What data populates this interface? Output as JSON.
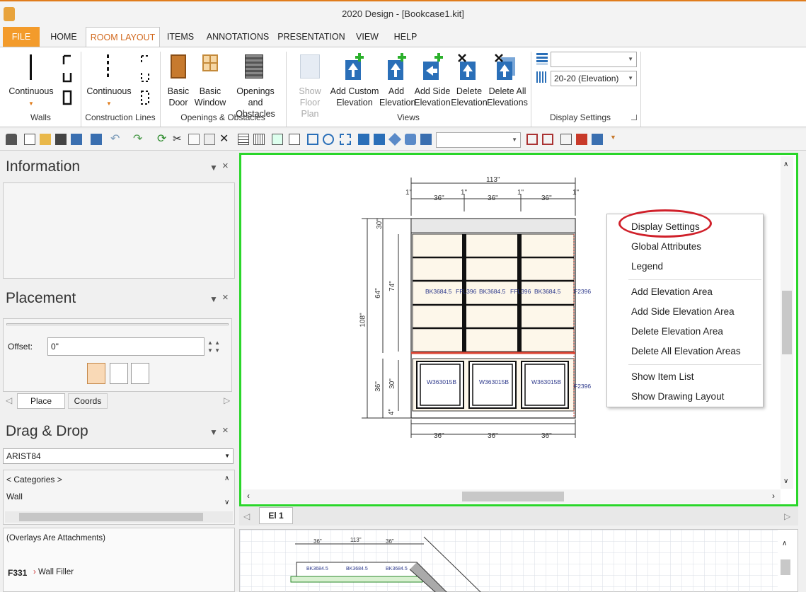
{
  "window": {
    "title": "2020 Design - [Bookcase1.kit]"
  },
  "tabs": [
    "FILE",
    "HOME",
    "ROOM LAYOUT",
    "ITEMS",
    "ANNOTATIONS",
    "PRESENTATION",
    "VIEW",
    "HELP"
  ],
  "ribbon": {
    "walls": {
      "continuous": "Continuous",
      "group": "Walls"
    },
    "construction": {
      "continuous": "Continuous",
      "group": "Construction Lines"
    },
    "openings": {
      "door": [
        "Basic",
        "Door"
      ],
      "window": [
        "Basic",
        "Window"
      ],
      "obstacles": [
        "Openings",
        "and Obstacles"
      ],
      "group": "Openings & Obstacles"
    },
    "views": {
      "show_floor": [
        "Show",
        "Floor Plan"
      ],
      "custom": [
        "Add Custom",
        "Elevation"
      ],
      "add": [
        "Add",
        "Elevation"
      ],
      "side": [
        "Add Side",
        "Elevation"
      ],
      "del": [
        "Delete",
        "Elevation"
      ],
      "delall": [
        "Delete All",
        "Elevations"
      ],
      "group": "Views"
    },
    "display": {
      "combo1": "",
      "combo2": "20-20 (Elevation)",
      "group": "Display Settings"
    }
  },
  "panels": {
    "information": "Information",
    "placement": "Placement",
    "offset_label": "Offset:",
    "offset_value": "0\"",
    "tab_place": "Place",
    "tab_coords": "Coords",
    "dragdrop": "Drag & Drop",
    "catalog": "ARIST84",
    "categories": "< Categories >",
    "wall": "Wall",
    "overlays": "(Overlays Are Attachments)",
    "item_code": "F331",
    "item_name": "Wall Filler"
  },
  "drawing": {
    "overall_width": "113\"",
    "top_segments": [
      "1\"",
      "36\"",
      "1\"",
      "36\"",
      "1\"",
      "36\"",
      "1\""
    ],
    "bottom_segments": [
      "36\"",
      "36\"",
      "36\""
    ],
    "upper_labels": [
      "BK3684.5",
      "FFL396",
      "BK3684.5",
      "FFL396",
      "BK3684.5",
      "F2396"
    ],
    "lower_labels": [
      "W363015B",
      "W363015B",
      "W363015B",
      "F2396"
    ],
    "left_dims": [
      "108\"",
      "64\"",
      "74\"",
      "36\"",
      "30\"",
      "4\"",
      "30\""
    ]
  },
  "context_menu": [
    "Display Settings",
    "Global Attributes",
    "Legend",
    "Add Elevation Area",
    "Add Side Elevation Area",
    "Delete Elevation Area",
    "Delete All Elevation Areas",
    "Show Item List",
    "Show Drawing Layout"
  ],
  "view_tab": "El 1",
  "plan": {
    "top_dims": [
      "36\"",
      "113\"",
      "36\""
    ],
    "labels": [
      "BK3684.5",
      "BK3684.5",
      "BK3684.5"
    ]
  }
}
